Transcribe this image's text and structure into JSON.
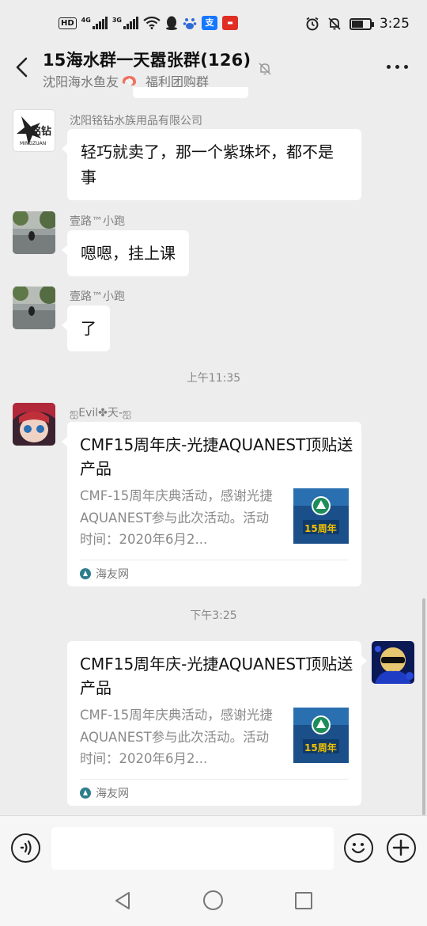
{
  "status_bar": {
    "hd_badge": "HD",
    "sim1": "1",
    "net1": "4G",
    "net2": "3G",
    "time": "3:25",
    "battery_level": 0.6,
    "app_icons": [
      "qq-icon",
      "baidu-icon",
      "alipay-icon",
      "news-icon"
    ]
  },
  "header": {
    "title": "15海水群一天嚣张群(126)",
    "subtitle_part1": "沈阳海水鱼友",
    "subtitle_part2": "福利团购群"
  },
  "messages": [
    {
      "sender": "沈阳铭钻水族用品有限公司",
      "avatar_text": "铭钻",
      "avatar_subtext": "MINGZUAN",
      "text": "轻巧就卖了，那一个紫珠坏，都不是事"
    },
    {
      "sender": "壹路™小跑",
      "text": "嗯嗯，挂上课"
    },
    {
      "sender": "壹路™小跑",
      "text": "了"
    }
  ],
  "timestamps": [
    "上午11:35",
    "下午3:25"
  ],
  "share_card_left": {
    "sender": "ஐEvil✤天-ஐ",
    "title": "CMF15周年庆-光捷AQUANEST顶贴送产品",
    "description": "CMF-15周年庆典活动，感谢光捷AQUANEST参与此次活动。活动时间：2020年6月2...",
    "thumb_text": "15周年",
    "source": "海友网"
  },
  "share_card_right": {
    "title": "CMF15周年庆-光捷AQUANEST顶贴送产品",
    "description": "CMF-15周年庆典活动，感谢光捷AQUANEST参与此次活动。活动时间：2020年6月2...",
    "thumb_text": "15周年",
    "source": "海友网"
  },
  "input": {
    "value": "",
    "placeholder": ""
  },
  "colors": {
    "background": "#ededed",
    "bubble": "#ffffff",
    "thumb_bg": "#1a4f8a",
    "thumb_accent": "#f2c200"
  }
}
